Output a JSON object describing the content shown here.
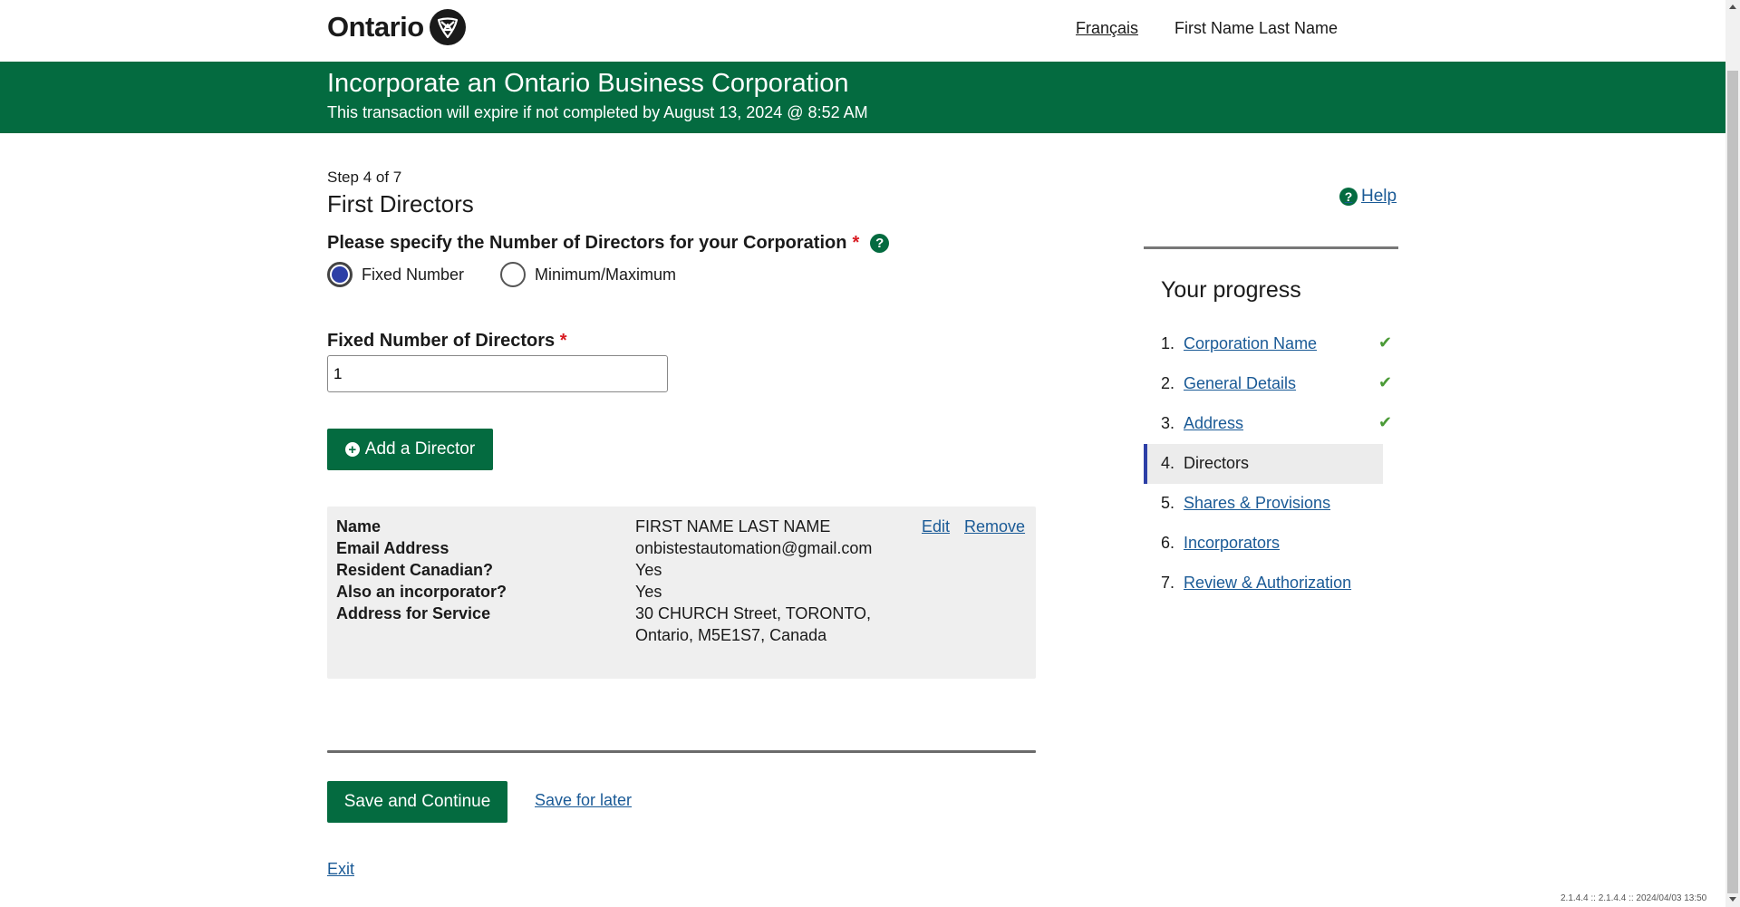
{
  "header": {
    "logo_text": "Ontario",
    "language_link": "Français",
    "user_name": "First Name Last Name"
  },
  "banner": {
    "title": "Incorporate an Ontario Business Corporation",
    "subtitle": "This transaction will expire if not completed by August 13, 2024 @ 8:52 AM"
  },
  "form": {
    "step": "Step 4 of 7",
    "title": "First Directors",
    "question": "Please specify the Number of Directors for your Corporation",
    "required_mark": "*",
    "help_icon_glyph": "?",
    "radio_options": [
      {
        "label": "Fixed Number",
        "selected": true
      },
      {
        "label": "Minimum/Maximum",
        "selected": false
      }
    ],
    "fixed_label": "Fixed Number of Directors",
    "fixed_value": "1",
    "add_director_label": "Add a Director"
  },
  "director": {
    "fields": [
      {
        "label": "Name",
        "value": "FIRST NAME LAST NAME"
      },
      {
        "label": "Email Address",
        "value": "onbistestautomation@gmail.com"
      },
      {
        "label": "Resident Canadian?",
        "value": "Yes"
      },
      {
        "label": "Also an incorporator?",
        "value": "Yes"
      },
      {
        "label": "Address for Service",
        "value_line1": "30 CHURCH Street, TORONTO,",
        "value_line2": "Ontario, M5E1S7, Canada"
      }
    ],
    "edit_label": "Edit",
    "remove_label": "Remove"
  },
  "footer_actions": {
    "save_continue": "Save and Continue",
    "save_later": "Save for later",
    "exit": "Exit"
  },
  "sidebar": {
    "help": "Help",
    "progress_title": "Your progress",
    "steps": [
      {
        "num": "1.",
        "label": "Corporation Name",
        "complete": true
      },
      {
        "num": "2.",
        "label": "General Details",
        "complete": true
      },
      {
        "num": "3.",
        "label": "Address",
        "complete": true
      },
      {
        "num": "4.",
        "label": "Directors",
        "current": true
      },
      {
        "num": "5.",
        "label": "Shares & Provisions"
      },
      {
        "num": "6.",
        "label": "Incorporators"
      },
      {
        "num": "7.",
        "label": "Review & Authorization"
      }
    ],
    "check_glyph": "✔"
  },
  "version": "2.1.4.4 :: 2.1.4.4 :: 2024/04/03 13:50",
  "colors": {
    "brand_green": "#046b40",
    "link_blue": "#1a5a96",
    "required_red": "#d81a21",
    "radio_selected": "#2d3fa6",
    "check_green": "#4a9a36"
  }
}
